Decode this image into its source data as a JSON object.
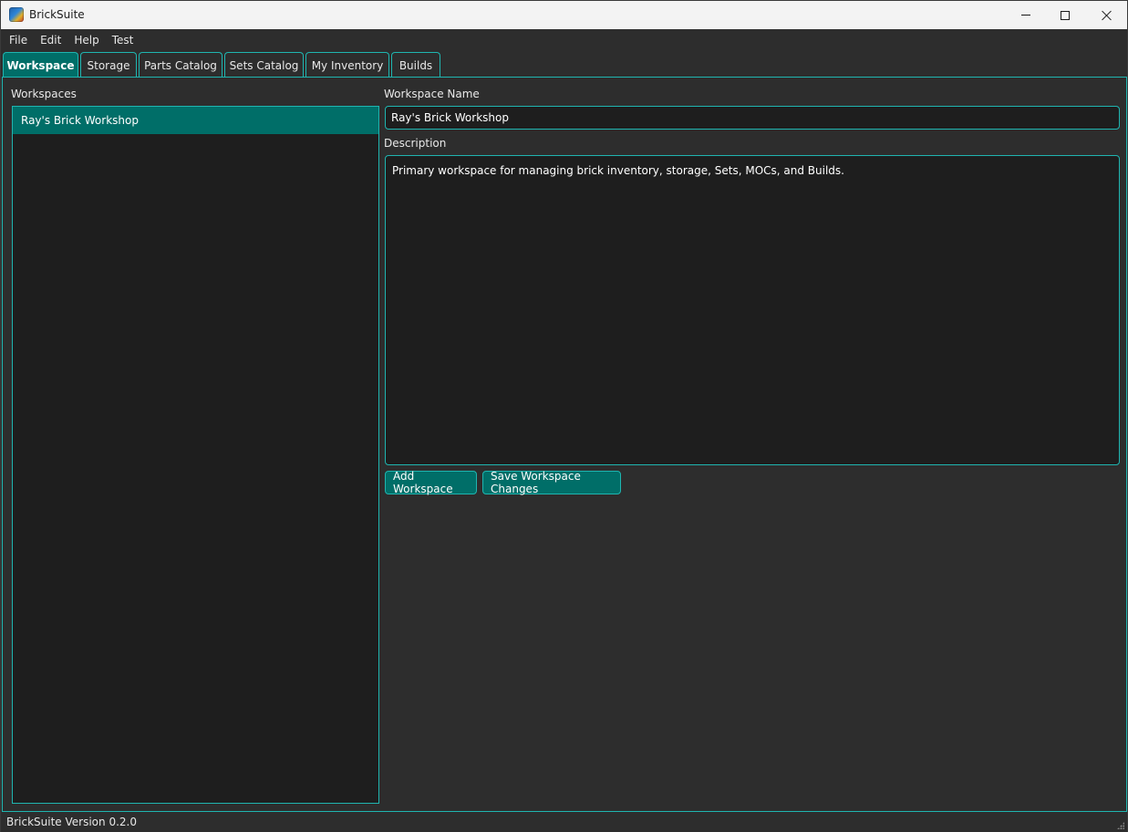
{
  "window": {
    "title": "BrickSuite"
  },
  "menu": {
    "items": [
      "File",
      "Edit",
      "Help",
      "Test"
    ]
  },
  "tabs": {
    "items": [
      {
        "label": "Workspace",
        "active": true
      },
      {
        "label": "Storage"
      },
      {
        "label": "Parts Catalog"
      },
      {
        "label": "Sets Catalog"
      },
      {
        "label": "My Inventory"
      },
      {
        "label": "Builds"
      }
    ]
  },
  "workspace": {
    "list_label": "Workspaces",
    "list_items": [
      "Ray's Brick Workshop"
    ],
    "name_label": "Workspace Name",
    "name_value": "Ray's Brick Workshop",
    "description_label": "Description",
    "description_value": "Primary workspace for managing brick inventory, storage, Sets, MOCs, and Builds.",
    "add_button": "Add Workspace",
    "save_button": "Save Workspace Changes"
  },
  "status": {
    "version_text": "BrickSuite Version 0.2.0"
  },
  "colors": {
    "accent": "#1fb5b0",
    "selected": "#006e68",
    "background": "#2d2d2d",
    "field": "#1e1e1e"
  }
}
